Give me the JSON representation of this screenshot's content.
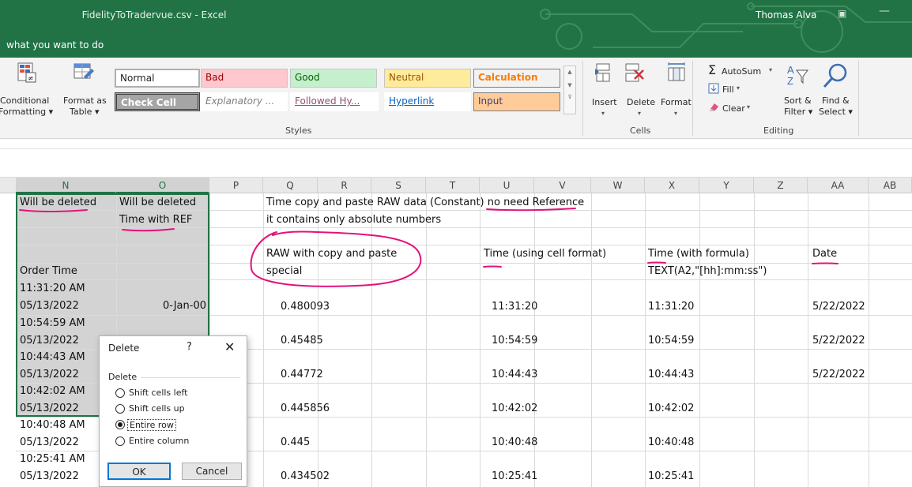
{
  "window": {
    "title": "FidelityToTradervue.csv  -  Excel",
    "tell_me": "what you want to do",
    "user": "Thomas Alva",
    "colors": {
      "titlebar": "#217346",
      "accent": "#217346"
    }
  },
  "ribbon": {
    "styles": {
      "conditional_formatting": [
        "Conditional",
        "Formatting ▾"
      ],
      "format_as_table": [
        "Format as",
        "Table ▾"
      ],
      "cells": [
        {
          "label": "Normal",
          "bg": "#ffffff",
          "fg": "#000000"
        },
        {
          "label": "Bad",
          "bg": "#ffc7ce",
          "fg": "#9c0006"
        },
        {
          "label": "Good",
          "bg": "#c6efce",
          "fg": "#006100"
        },
        {
          "label": "Neutral",
          "bg": "#ffeb9c",
          "fg": "#9c5700"
        },
        {
          "label": "Calculation",
          "bg": "#f2f2f2",
          "fg": "#fa7d00"
        },
        {
          "label": "Check Cell",
          "bg": "#a5a5a5",
          "fg": "#ffffff"
        },
        {
          "label": "Explanatory ...",
          "bg": "#ffffff",
          "fg": "#7f7f7f"
        },
        {
          "label": "Followed Hy...",
          "bg": "#ffffff",
          "fg": "#954f72"
        },
        {
          "label": "Hyperlink",
          "bg": "#ffffff",
          "fg": "#0563c1"
        },
        {
          "label": "Input",
          "bg": "#ffcc99",
          "fg": "#3f3f76"
        }
      ],
      "group_label": "Styles"
    },
    "cells_group": {
      "insert": "Insert",
      "delete": "Delete",
      "format": "Format",
      "group_label": "Cells"
    },
    "editing": {
      "autosum": "AutoSum",
      "fill": "Fill",
      "clear": "Clear",
      "sort_filter": [
        "Sort &",
        "Filter ▾"
      ],
      "find_select": [
        "Find &",
        "Select ▾"
      ],
      "group_label": "Editing"
    }
  },
  "grid": {
    "columns": [
      "N",
      "O",
      "P",
      "Q",
      "R",
      "S",
      "T",
      "U",
      "V",
      "W",
      "X",
      "Y",
      "Z",
      "AA",
      "AB"
    ],
    "N": [
      "Will be deleted",
      "",
      "",
      "",
      "Order Time",
      "11:31:20 AM",
      "05/13/2022",
      "10:54:59 AM",
      "05/13/2022",
      "10:44:43 AM",
      "05/13/2022",
      "10:42:02 AM",
      "05/13/2022",
      "10:40:48 AM",
      "05/13/2022",
      "10:25:41 AM",
      "05/13/2022"
    ],
    "O": [
      "Will be deleted",
      "Time with REF",
      "0-Jan-00"
    ],
    "Q": [
      "Time copy and paste RAW data (Constant) no need Reference",
      "it contains only absolute numbers",
      "RAW with copy and paste",
      "special"
    ],
    "Q_values": [
      "0.480093",
      "0.45485",
      "0.44772",
      "0.445856",
      "0.445",
      "0.434502"
    ],
    "U_header": "Time (using cell format)",
    "U_values": [
      "11:31:20",
      "10:54:59",
      "10:44:43",
      "10:42:02",
      "10:40:48",
      "10:25:41"
    ],
    "X_header": [
      "Time (with formula)",
      "TEXT(A2,\"[hh]:mm:ss\")"
    ],
    "X_values": [
      "11:31:20",
      "10:54:59",
      "10:44:43",
      "10:42:02",
      "10:40:48",
      "10:25:41"
    ],
    "AA_header": "Date",
    "AA_values": [
      "5/22/2022",
      "5/22/2022",
      "5/22/2022"
    ]
  },
  "dialog": {
    "title": "Delete",
    "help": "?",
    "close": "✕",
    "section": "Delete",
    "options": [
      "Shift cells left",
      "Shift cells up",
      "Entire row",
      "Entire column"
    ],
    "selected": "Entire row",
    "ok": "OK",
    "cancel": "Cancel"
  }
}
